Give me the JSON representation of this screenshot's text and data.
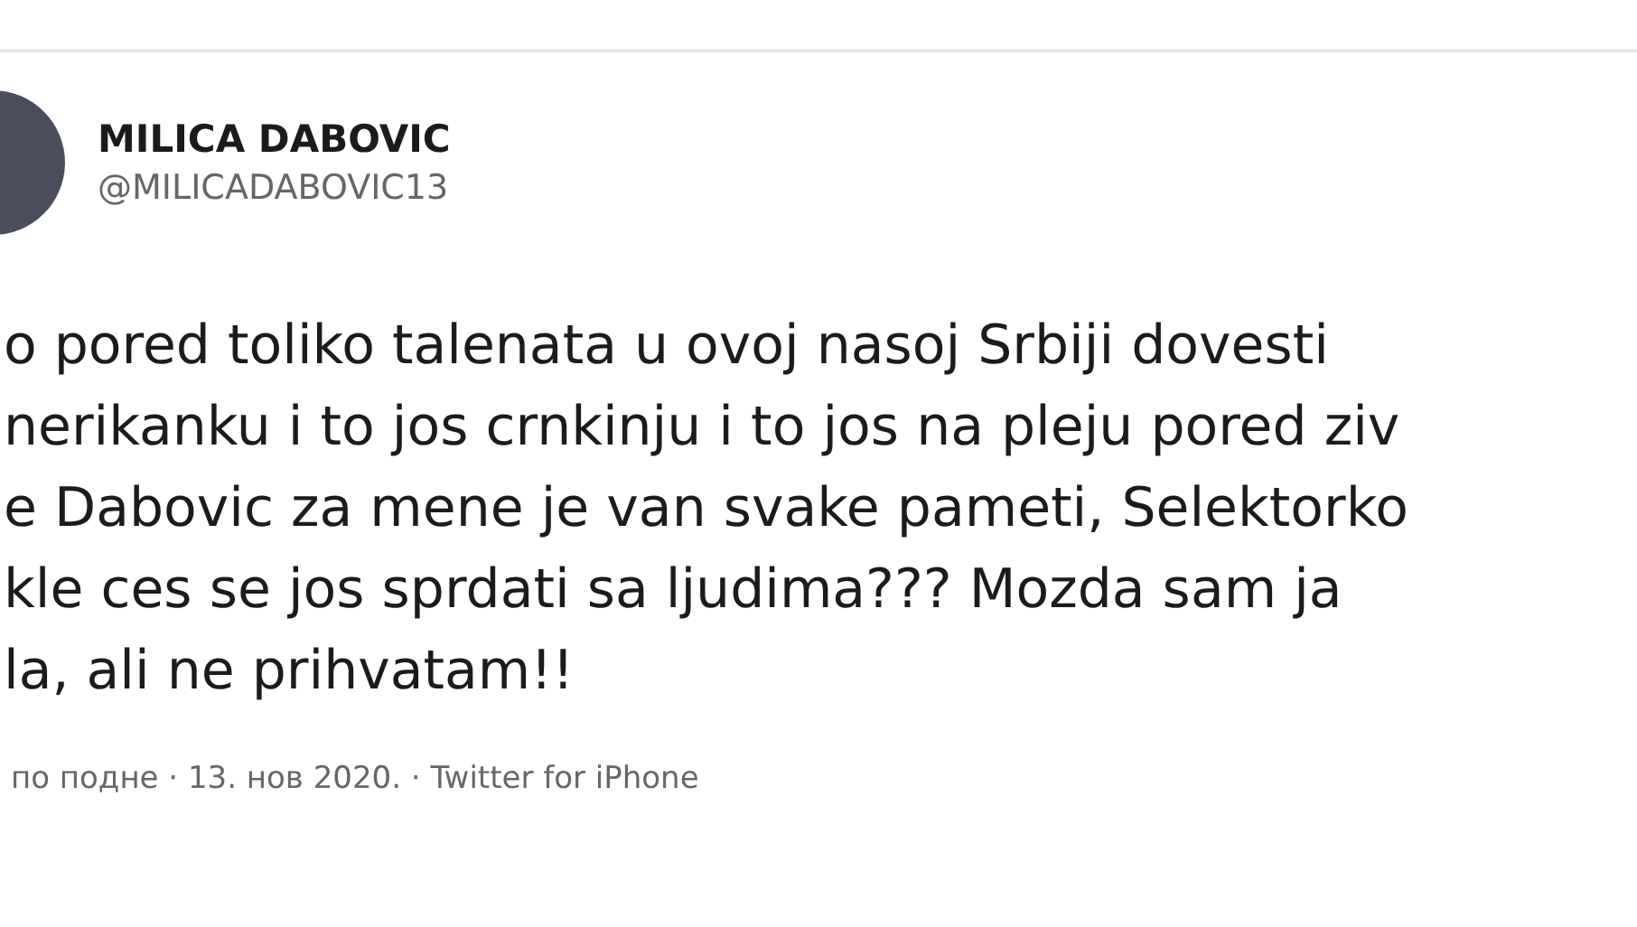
{
  "tweet": {
    "author": {
      "name": "MILICA DABOVIC",
      "handle": "@MILICADABOVIC13"
    },
    "text_lines": [
      "o pored toliko talenata u ovoj nasoj Srbiji dovesti",
      "nerikanku i to jos crnkinju i to jos na pleju pored ziv",
      "e Dabovic za mene je van svake pameti, Selektorko",
      "kle ces se jos sprdati sa ljudima??? Mozda sam ja",
      "la, ali ne prihvatam!!"
    ],
    "meta": "по подне · 13. нов 2020. · Twitter for iPhone"
  }
}
